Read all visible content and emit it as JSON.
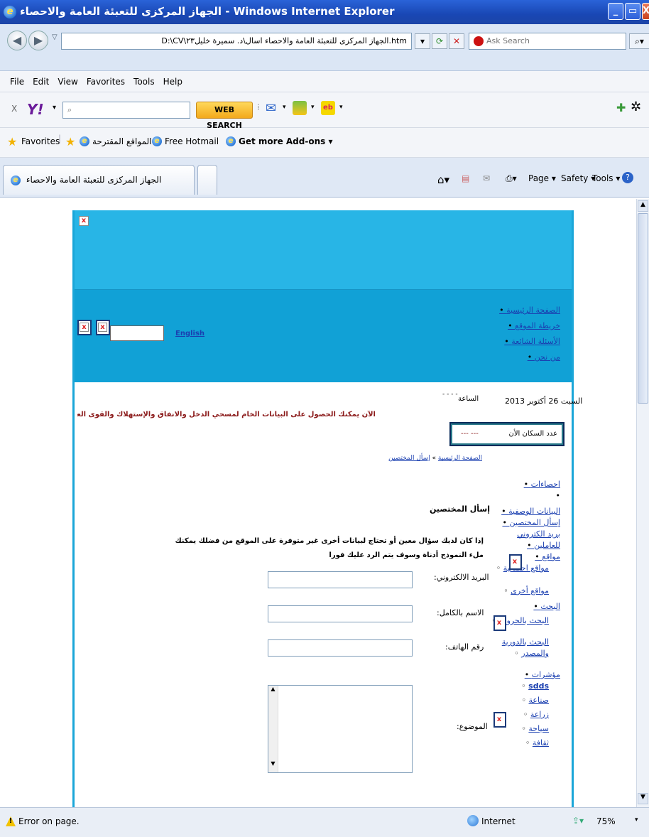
{
  "window": {
    "title": "الجهاز المركزى للتعبئة العامة والاحصاء - Windows Internet Explorer",
    "controls": {
      "minimize": "_",
      "maximize": "▭",
      "close": "X"
    }
  },
  "address": {
    "url": "D:\\CV\\الجهاز المركزى للتعبئة العامة والاحصاء اسال\\د. سميرة خليل٢٣.htm",
    "search_placeholder": "Ask Search"
  },
  "menu": [
    "File",
    "Edit",
    "View",
    "Favorites",
    "Tools",
    "Help"
  ],
  "yahoo": {
    "close": "X",
    "logo": "Y!",
    "search_btn": "WEB SEARCH"
  },
  "favorites": {
    "label": "Favorites",
    "items": [
      "المواقع المقترحة ▾",
      "Free Hotmail",
      "Get more Add-ons ▾"
    ]
  },
  "tab": {
    "title": "الجهاز المركزى للتعبئة العامة والاحصاء",
    "cmd": [
      "Page ▾",
      "Safety ▾",
      "Tools ▾"
    ]
  },
  "page": {
    "english_link": "English",
    "top_nav": [
      "الصفحة الرئيسية",
      "خريطة الموقع",
      "الأسئلة الشائعة",
      "من نحن"
    ],
    "date": "السبت 26 أكتوبر 2013",
    "time_label": "الساعة",
    "time_value": "- - - -",
    "population_label": "عدد السكان الأن",
    "population_value": "--- ---",
    "marquee": "الآن يمكنك الحصول على البيانات الخام لمسحي الدخل والانفاق والإستهلاك والقوى العاملة وذلك من خلال ال",
    "breadcrumb": {
      "home": "الصفحة الرئيسية",
      "sep": " » ",
      "current": "إسأل المختصين"
    },
    "heading": "إسأل المختصين",
    "intro": "إذا كان لديك سؤال معين أو تحتاج لبيانات أخرى غير متوفرة على الموقع من فضلك يمكنك ملء النموذج أدناة وسوف يتم الرد عليك فورا",
    "form": {
      "email": "البريد الالكتروني:",
      "name": "الاسم بالكامل:",
      "phone": "رقم الهاتف:",
      "subject": "الموضوع:"
    },
    "side_nav": [
      "احصاءات",
      "",
      "البيانات الوصفية",
      "إسأل المختصين",
      "بريد الكتروني للعاملين",
      "مواقع",
      "مواقع احصائية",
      "مواقع أخرى",
      "البحث",
      "البحث بالحروف",
      "البحث بالدورية والمصدر",
      "مؤشرات",
      "sdds",
      "صناعة",
      "زراعة",
      "سياحة",
      "ثقافة"
    ]
  },
  "status": {
    "left": "Error on page.",
    "zone": "Internet",
    "zoom": "75%"
  }
}
